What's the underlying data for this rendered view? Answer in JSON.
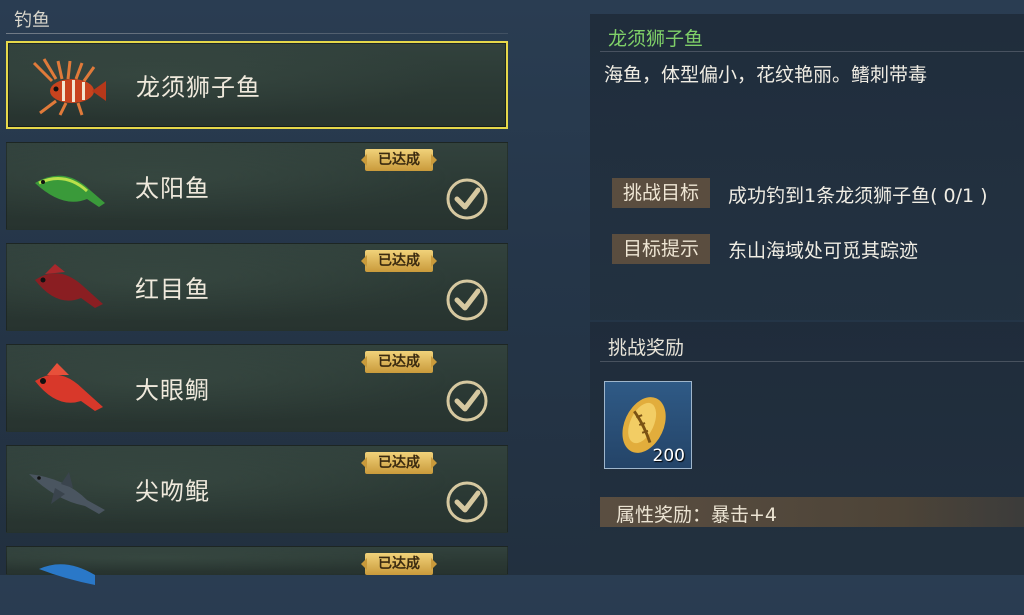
{
  "left_header": "钓鱼",
  "fish_list": [
    {
      "name": "龙须狮子鱼",
      "badge": "",
      "completed": false,
      "selected": true
    },
    {
      "name": "太阳鱼",
      "badge": "已达成",
      "completed": true,
      "selected": false
    },
    {
      "name": "红目鱼",
      "badge": "已达成",
      "completed": true,
      "selected": false
    },
    {
      "name": "大眼鲷",
      "badge": "已达成",
      "completed": true,
      "selected": false
    },
    {
      "name": "尖吻鲲",
      "badge": "已达成",
      "completed": true,
      "selected": false
    },
    {
      "name": "",
      "badge": "已达成",
      "completed": true,
      "selected": false
    }
  ],
  "detail": {
    "title": "龙须狮子鱼",
    "description": "海鱼，体型偏小，花纹艳丽。鳍刺带毒",
    "goal_label": "挑战目标",
    "goal_text": "成功钓到1条龙须狮子鱼( 0/1 )",
    "hint_label": "目标提示",
    "hint_text": "东山海域处可觅其踪迹"
  },
  "reward": {
    "title": "挑战奖励",
    "item_icon": "gold-cowrie-shell-icon",
    "item_count": "200",
    "attribute": "属性奖励：暴击+4"
  },
  "colors": {
    "selected_border": "#e6d84a",
    "title_green": "#7fd068",
    "badge_gold": "#e0b85a"
  }
}
